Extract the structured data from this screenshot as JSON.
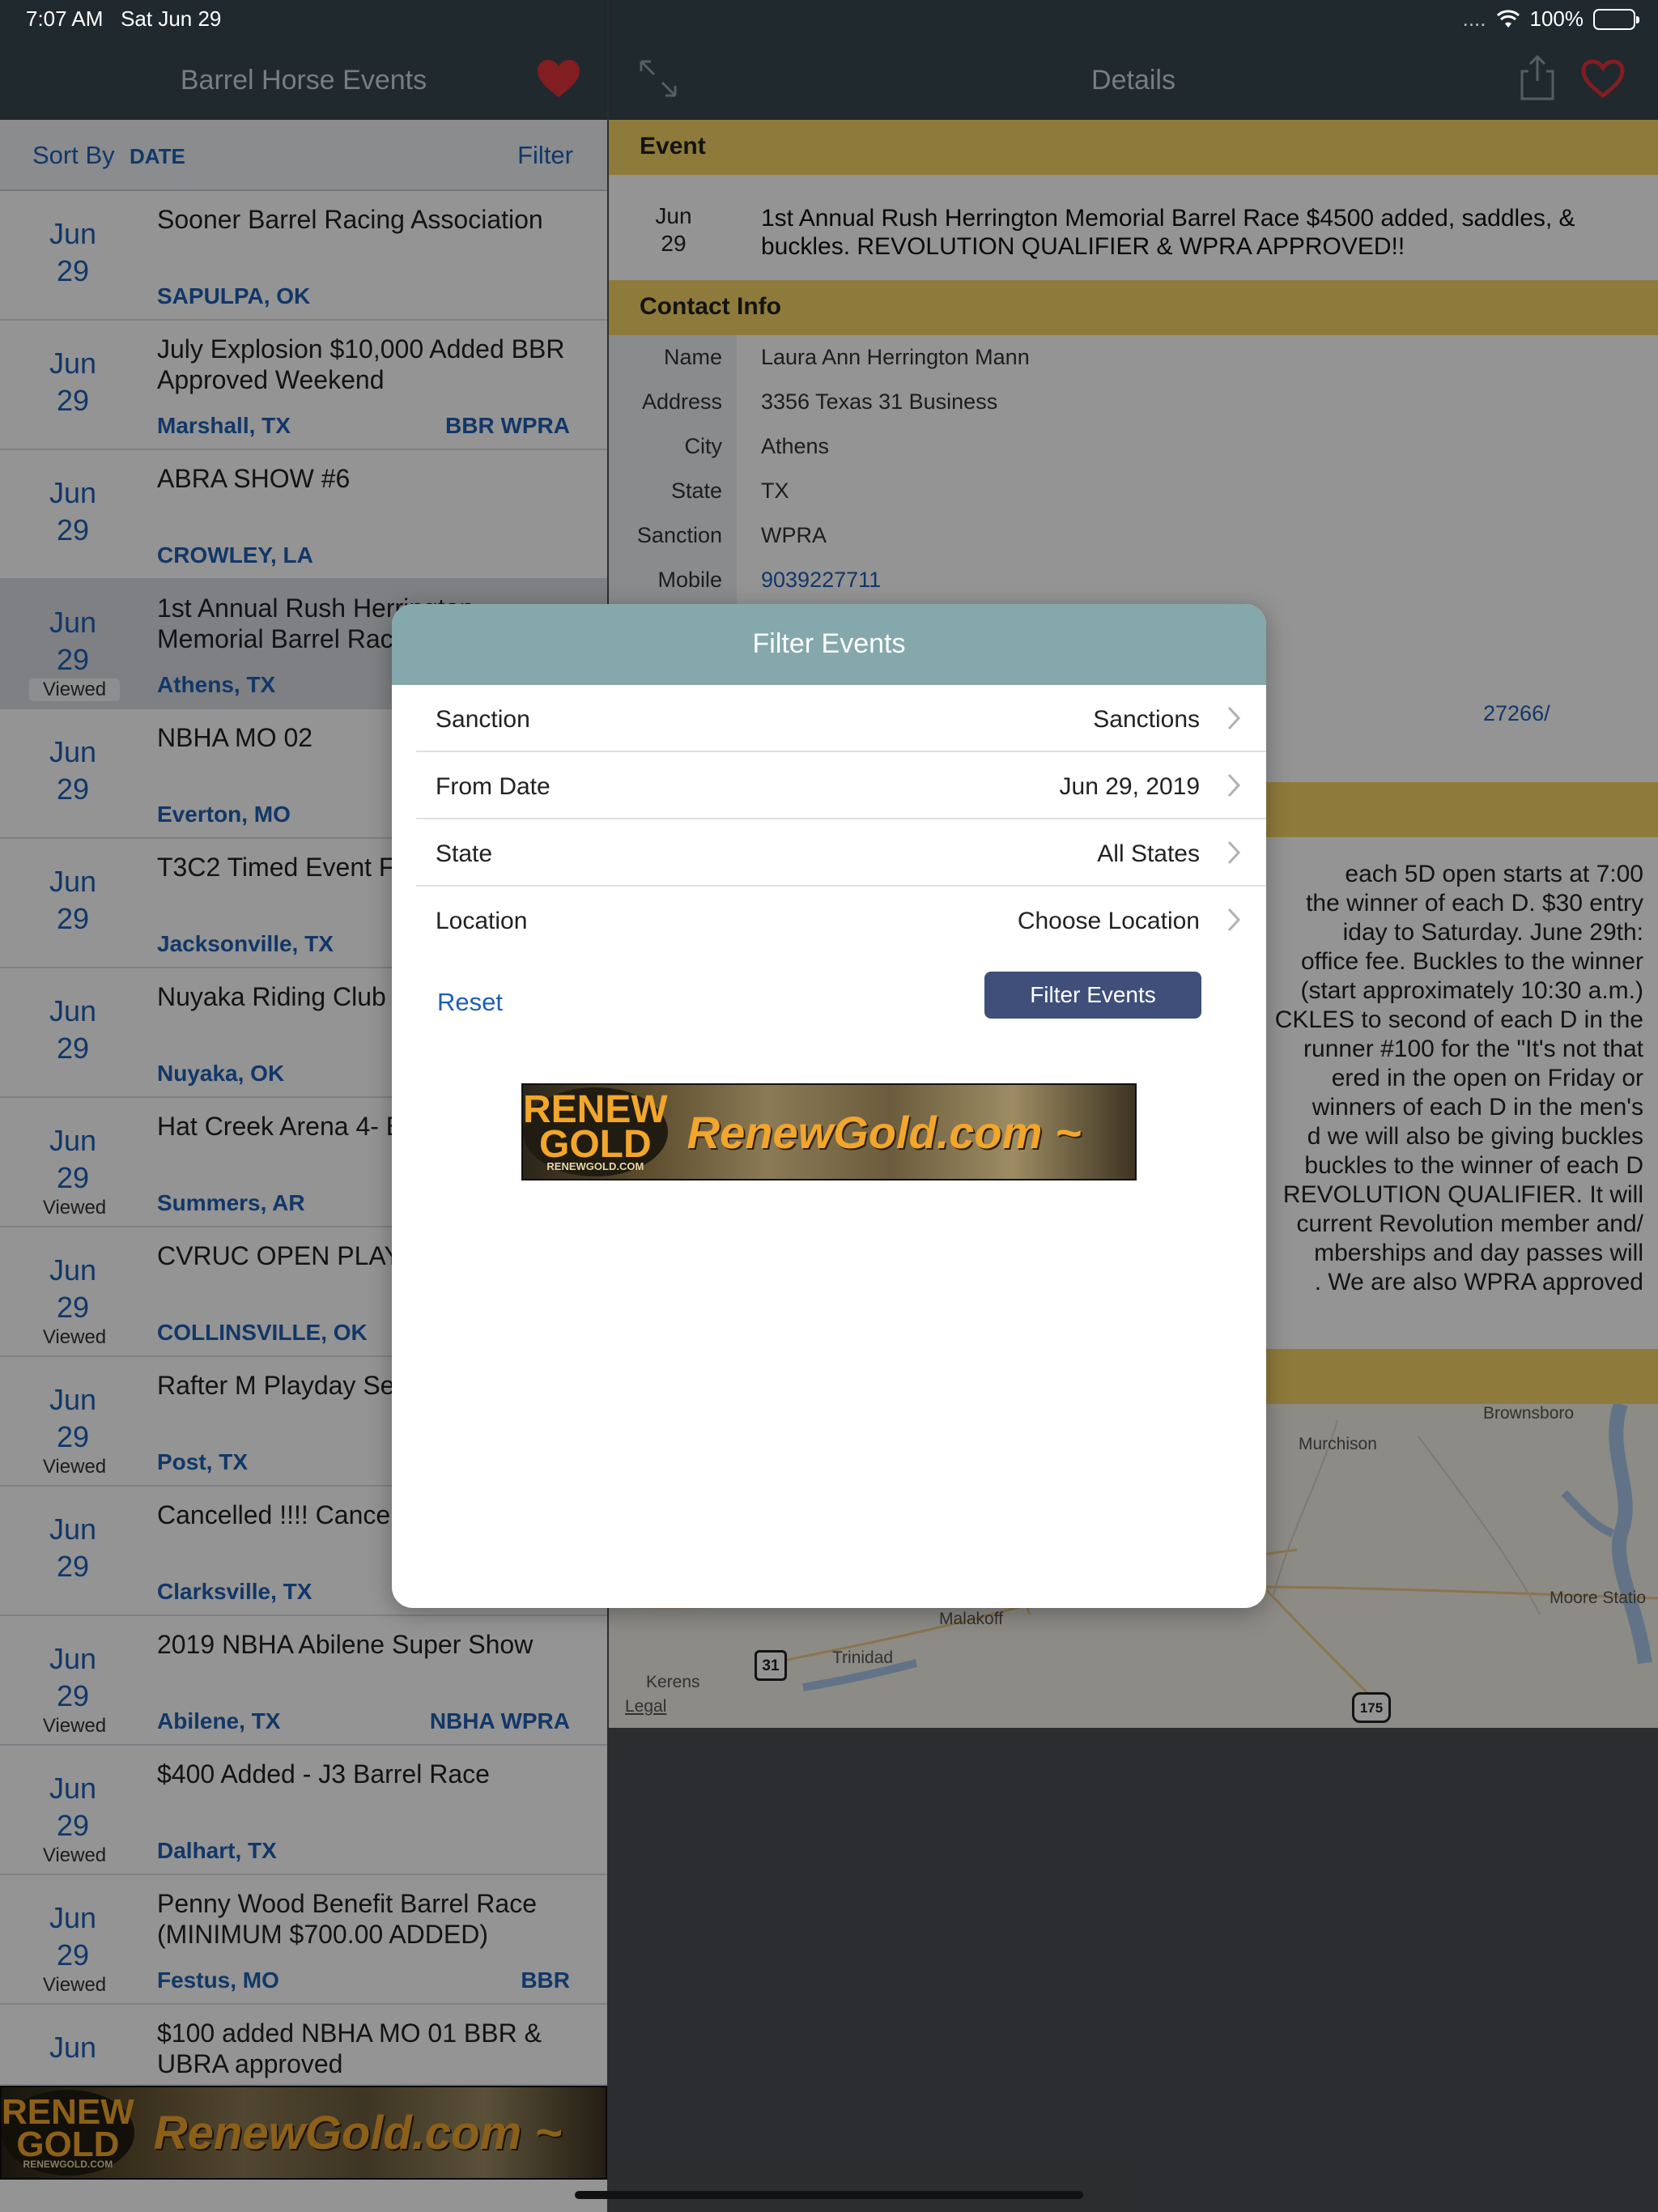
{
  "status": {
    "time": "7:07 AM",
    "date": "Sat Jun 29",
    "battery": "100%",
    "signal": "....",
    "wifi_icon": "wifi-icon"
  },
  "master": {
    "title": "Barrel Horse Events",
    "sort_label": "Sort By",
    "sort_value": "DATE",
    "filter_label": "Filter",
    "rows": [
      {
        "month": "Jun",
        "day": "29",
        "title": "Sooner Barrel Racing Association",
        "location": "SAPULPA, OK",
        "sanction": "",
        "viewed": ""
      },
      {
        "month": "Jun",
        "day": "29",
        "title": "July Explosion $10,000 Added BBR Approved Weekend",
        "location": "Marshall, TX",
        "sanction": "BBR WPRA",
        "viewed": ""
      },
      {
        "month": "Jun",
        "day": "29",
        "title": "ABRA SHOW #6",
        "location": "CROWLEY, LA",
        "sanction": "",
        "viewed": ""
      },
      {
        "month": "Jun",
        "day": "29",
        "title": "1st Annual Rush Herrington Memorial Barrel Race",
        "location": "Athens, TX",
        "sanction": "",
        "viewed": "Viewed"
      },
      {
        "month": "Jun",
        "day": "29",
        "title": "NBHA MO 02",
        "location": "Everton, MO",
        "sanction": "",
        "viewed": ""
      },
      {
        "month": "Jun",
        "day": "29",
        "title": "T3C2 Timed Event F",
        "location": "Jacksonville, TX",
        "sanction": "",
        "viewed": ""
      },
      {
        "month": "Jun",
        "day": "29",
        "title": "Nuyaka Riding Club",
        "location": "Nuyaka, OK",
        "sanction": "",
        "viewed": ""
      },
      {
        "month": "Jun",
        "day": "29",
        "title": "Hat Creek Arena 4- Barrel Race",
        "location": "Summers, AR",
        "sanction": "",
        "viewed": "Viewed"
      },
      {
        "month": "Jun",
        "day": "29",
        "title": "CVRUC OPEN PLAY",
        "location": "COLLINSVILLE, OK",
        "sanction": "",
        "viewed": "Viewed"
      },
      {
        "month": "Jun",
        "day": "29",
        "title": "Rafter M Playday Se",
        "location": "Post, TX",
        "sanction": "",
        "viewed": "Viewed"
      },
      {
        "month": "Jun",
        "day": "29",
        "title": "Cancelled !!!! Cance Tx 20",
        "location": "Clarksville, TX",
        "sanction": "",
        "viewed": ""
      },
      {
        "month": "Jun",
        "day": "29",
        "title": "2019 NBHA Abilene Super Show",
        "location": "Abilene, TX",
        "sanction": "NBHA WPRA",
        "viewed": "Viewed"
      },
      {
        "month": "Jun",
        "day": "29",
        "title": "$400 Added - J3 Barrel Race",
        "location": "Dalhart, TX",
        "sanction": "",
        "viewed": "Viewed"
      },
      {
        "month": "Jun",
        "day": "29",
        "title": "Penny Wood Benefit Barrel Race (MINIMUM $700.00 ADDED)",
        "location": "Festus, MO",
        "sanction": "BBR",
        "viewed": "Viewed"
      },
      {
        "month": "Jun",
        "day": "",
        "title": "$100 added NBHA MO 01 BBR & UBRA approved",
        "location": "",
        "sanction": "",
        "viewed": ""
      }
    ]
  },
  "ad": {
    "logo_top": "RENEW",
    "logo_bottom": "GOLD",
    "logo_small": "RENEWGOLD.COM",
    "url": "RenewGold.com ~"
  },
  "detail": {
    "title": "Details",
    "event_header": "Event",
    "event_month": "Jun",
    "event_day": "29",
    "event_title": "1st Annual Rush Herrington Memorial Barrel Race $4500 added, saddles, & buckles. REVOLUTION QUALIFIER & WPRA APPROVED!!",
    "contact_header": "Contact Info",
    "contact": [
      {
        "label": "Name",
        "value": "Laura Ann Herrington Mann",
        "link": false
      },
      {
        "label": "Address",
        "value": "3356 Texas 31 Business",
        "link": false
      },
      {
        "label": "City",
        "value": "Athens",
        "link": false
      },
      {
        "label": "State",
        "value": "TX",
        "link": false
      },
      {
        "label": "Sanction",
        "value": "WPRA",
        "link": false
      },
      {
        "label": "Mobile",
        "value": "9039227711",
        "link": true
      }
    ],
    "partial_url": "27266/",
    "description_lines": [
      "each 5D open starts at 7:00",
      "the winner of each D. $30 entry",
      "iday to Saturday.   June 29th:",
      "office fee. Buckles to the winner",
      "(start approximately 10:30 a.m.)",
      "CKLES to second of each D in the",
      "runner #100 for the \"It's not that",
      "ered in the open on Friday or",
      "winners of each D in the men's",
      "d we will also be giving buckles",
      "buckles to the winner of each D",
      "REVOLUTION QUALIFIER. It will",
      "current Revolution member and/",
      "mberships and day passes will",
      ".    We are also WPRA approved"
    ],
    "map_labels": {
      "brownsboro": "Brownsboro",
      "murchison": "Murchison",
      "malakoff": "Malakoff",
      "trinidad": "Trinidad",
      "kerens": "Kerens",
      "moore": "Moore Statio",
      "legal": "Legal",
      "hwy31": "31",
      "hwy175": "175"
    }
  },
  "modal": {
    "title": "Filter Events",
    "rows": [
      {
        "label": "Sanction",
        "value": "Sanctions"
      },
      {
        "label": "From Date",
        "value": "Jun 29, 2019"
      },
      {
        "label": "State",
        "value": "All States"
      },
      {
        "label": "Location",
        "value": "Choose Location"
      }
    ],
    "reset_label": "Reset",
    "button_label": "Filter Events"
  },
  "colors": {
    "nav": "#37474f",
    "accent": "#1f5fb3",
    "heart": "#e0333b",
    "section": "#f4d466",
    "modal_header": "#84a8ab",
    "button": "#3f4f7a"
  }
}
